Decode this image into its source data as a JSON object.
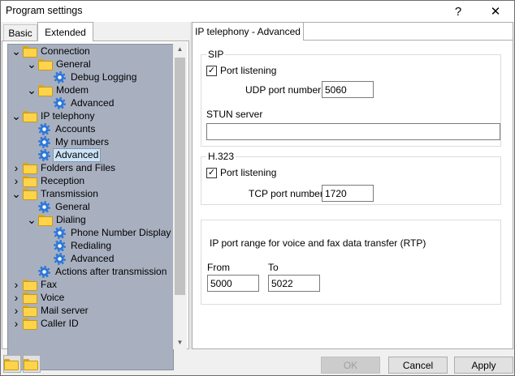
{
  "window": {
    "title": "Program settings",
    "help": "?",
    "close": "✕"
  },
  "tabs": {
    "basic": "Basic",
    "extended": "Extended"
  },
  "tree": {
    "items": [
      {
        "label": "Connection",
        "level": 0,
        "icon": "folder-open-icon",
        "toggle": "expanded"
      },
      {
        "label": "General",
        "level": 1,
        "icon": "folder-open-icon",
        "toggle": "expanded"
      },
      {
        "label": "Debug Logging",
        "level": 2,
        "icon": "gear-icon",
        "toggle": "none"
      },
      {
        "label": "Modem",
        "level": 1,
        "icon": "folder-open-icon",
        "toggle": "expanded"
      },
      {
        "label": "Advanced",
        "level": 2,
        "icon": "gear-icon",
        "toggle": "none"
      },
      {
        "label": "IP telephony",
        "level": 0,
        "icon": "folder-open-icon",
        "toggle": "expanded"
      },
      {
        "label": "Accounts",
        "level": 1,
        "icon": "gear-icon",
        "toggle": "none"
      },
      {
        "label": "My numbers",
        "level": 1,
        "icon": "gear-icon",
        "toggle": "none"
      },
      {
        "label": "Advanced",
        "level": 1,
        "icon": "gear-icon",
        "toggle": "none",
        "selected": true
      },
      {
        "label": "Folders and Files",
        "level": 0,
        "icon": "folder-icon",
        "toggle": "collapsed"
      },
      {
        "label": "Reception",
        "level": 0,
        "icon": "folder-icon",
        "toggle": "collapsed"
      },
      {
        "label": "Transmission",
        "level": 0,
        "icon": "folder-open-icon",
        "toggle": "expanded"
      },
      {
        "label": "General",
        "level": 1,
        "icon": "gear-icon",
        "toggle": "none"
      },
      {
        "label": "Dialing",
        "level": 1,
        "icon": "folder-open-icon",
        "toggle": "expanded"
      },
      {
        "label": "Phone Number Display",
        "level": 2,
        "icon": "gear-icon",
        "toggle": "none"
      },
      {
        "label": "Redialing",
        "level": 2,
        "icon": "gear-icon",
        "toggle": "none"
      },
      {
        "label": "Advanced",
        "level": 2,
        "icon": "gear-icon",
        "toggle": "none"
      },
      {
        "label": "Actions after transmission",
        "level": 1,
        "icon": "gear-icon",
        "toggle": "none"
      },
      {
        "label": "Fax",
        "level": 0,
        "icon": "folder-icon",
        "toggle": "collapsed"
      },
      {
        "label": "Voice",
        "level": 0,
        "icon": "folder-icon",
        "toggle": "collapsed"
      },
      {
        "label": "Mail server",
        "level": 0,
        "icon": "folder-icon",
        "toggle": "collapsed"
      },
      {
        "label": "Caller ID",
        "level": 0,
        "icon": "folder-icon",
        "toggle": "collapsed"
      }
    ]
  },
  "section_tab": "IP telephony - Advanced",
  "sip": {
    "title": "SIP",
    "port_listening_label": "Port listening",
    "port_listening_checked": true,
    "udp_label": "UDP port number",
    "udp_value": "5060",
    "stun_label": "STUN server",
    "stun_value": ""
  },
  "h323": {
    "title": "H.323",
    "port_listening_label": "Port listening",
    "port_listening_checked": true,
    "tcp_label": "TCP port number",
    "tcp_value": "1720"
  },
  "rtp": {
    "title": "IP port range for voice and fax data transfer (RTP)",
    "from_label": "From",
    "from_value": "5000",
    "to_label": "To",
    "to_value": "5022"
  },
  "buttons": {
    "ok": "OK",
    "cancel": "Cancel",
    "apply": "Apply"
  }
}
